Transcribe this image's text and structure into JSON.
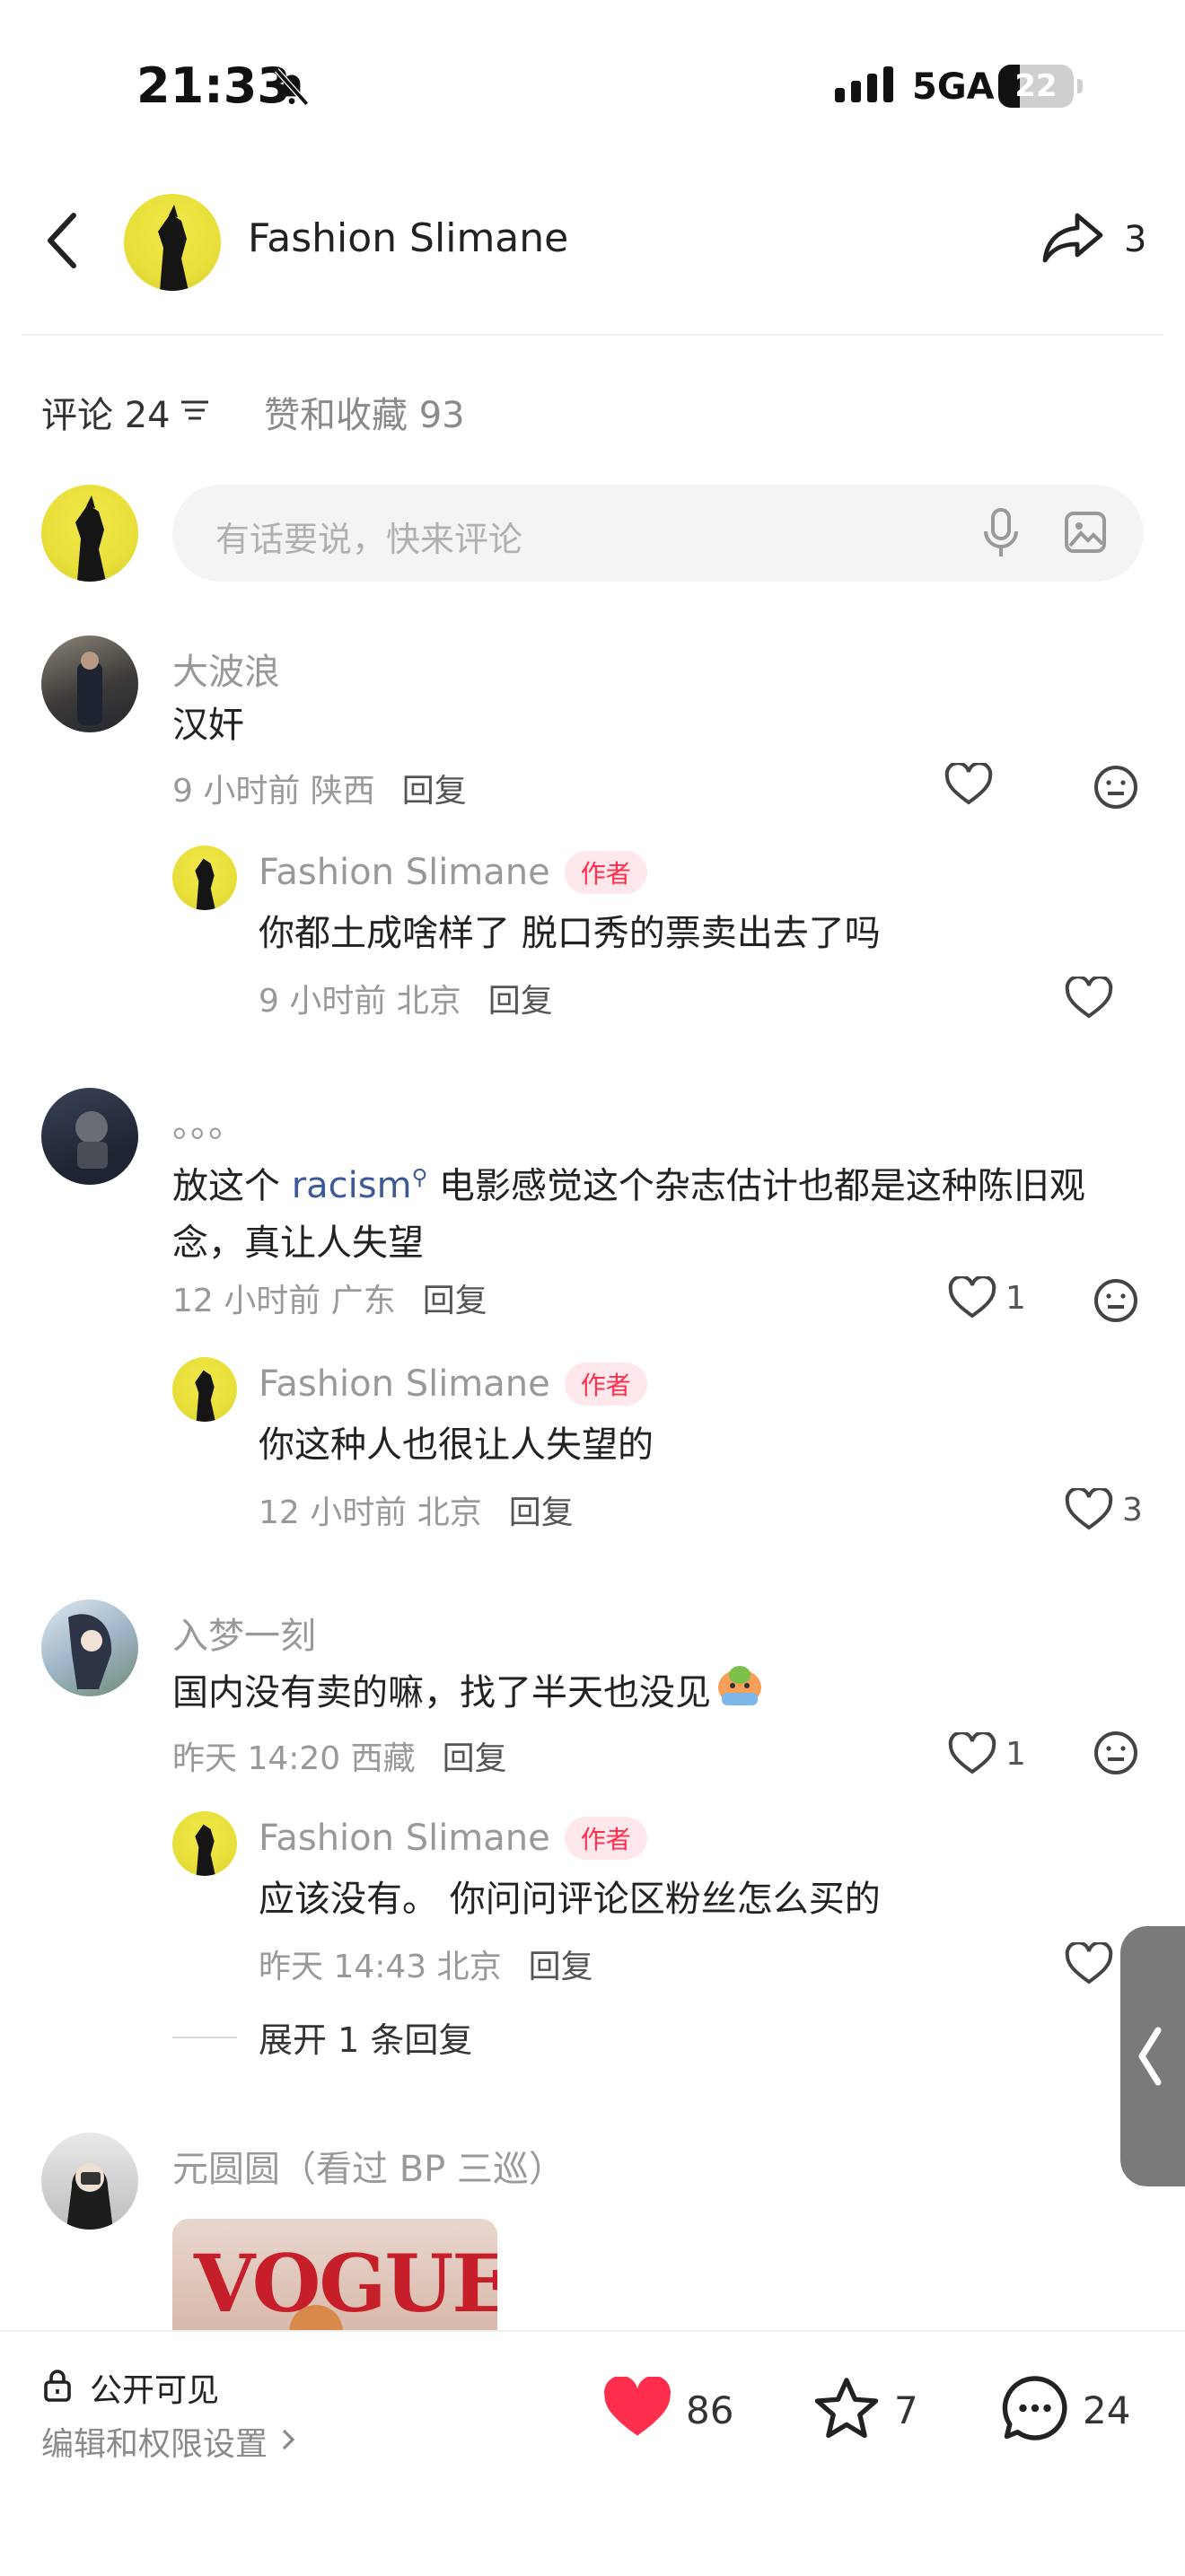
{
  "status_bar": {
    "time": "21:33",
    "network": "5GA",
    "battery": "22"
  },
  "header": {
    "title": "Fashion Slimane",
    "share_count": "3"
  },
  "tabs": {
    "comments_label": "评论 24",
    "likes_label": "赞和收藏 93"
  },
  "comment_input": {
    "placeholder": "有话要说，快来评论"
  },
  "author_tag": "作者",
  "reply_label": "回复",
  "comments": [
    {
      "name": "大波浪",
      "text": "汉奸",
      "time_loc": "9 小时前 陕西",
      "likes": "",
      "reply": {
        "name": "Fashion Slimane",
        "text": "你都土成啥样了 脱口秀的票卖出去了吗",
        "time_loc": "9 小时前 北京",
        "likes": ""
      }
    },
    {
      "name": "。。。",
      "text_pre": "放这个 ",
      "text_link": "racism",
      "text_post": " 电影感觉这个杂志估计也都是这种陈旧观念，真让人失望",
      "time_loc": "12 小时前 广东",
      "likes": "1",
      "reply": {
        "name": "Fashion Slimane",
        "text": "你这种人也很让人失望的",
        "time_loc": "12 小时前 北京",
        "likes": "3"
      }
    },
    {
      "name": "入梦一刻",
      "text": "国内没有卖的嘛，找了半天也没见",
      "time_loc": "昨天 14:20 西藏",
      "likes": "1",
      "reply": {
        "name": "Fashion Slimane",
        "text": "应该没有。 你问问评论区粉丝怎么买的",
        "time_loc": "昨天 14:43 北京",
        "likes": ""
      },
      "expand": "展开 1 条回复"
    },
    {
      "name": "元圆圆（看过 BP 三巡）",
      "image_text": "VOGUE"
    }
  ],
  "footer": {
    "visibility": "公开可见",
    "settings": "编辑和权限设置",
    "likes": "86",
    "favorites": "7",
    "comments": "24"
  },
  "colors": {
    "accent_red": "#ff2e4d",
    "link_blue": "#3c5a99"
  }
}
